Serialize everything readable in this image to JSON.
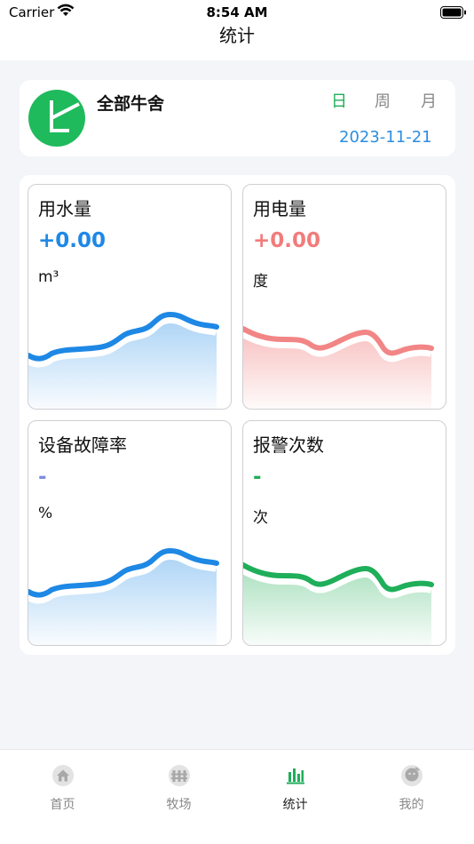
{
  "status_bar": {
    "carrier": "Carrier",
    "time": "8:54 AM"
  },
  "nav": {
    "title": "统计"
  },
  "header": {
    "barn_name": "全部牛舍",
    "periods": [
      "日",
      "周",
      "月"
    ],
    "active_period": "日",
    "date": "2023-11-21"
  },
  "stats": [
    {
      "title": "用水量",
      "value": "+0.00",
      "unit": "m³",
      "color": "#1e88e5"
    },
    {
      "title": "用电量",
      "value": "+0.00",
      "unit": "度",
      "color": "#f27b7b"
    },
    {
      "title": "设备故障率",
      "value": "-",
      "unit": "%",
      "color": "#7a8ee0"
    },
    {
      "title": "报警次数",
      "value": "-",
      "unit": "次",
      "color": "#1fae5a"
    }
  ],
  "tab_bar": {
    "items": [
      {
        "label": "首页",
        "icon": "home-icon"
      },
      {
        "label": "牧场",
        "icon": "fence-icon"
      },
      {
        "label": "统计",
        "icon": "bar-chart-icon"
      },
      {
        "label": "我的",
        "icon": "profile-icon"
      }
    ],
    "active": "统计"
  },
  "colors": {
    "accent_green": "#1fae5a",
    "date_blue": "#2c8ee0"
  }
}
